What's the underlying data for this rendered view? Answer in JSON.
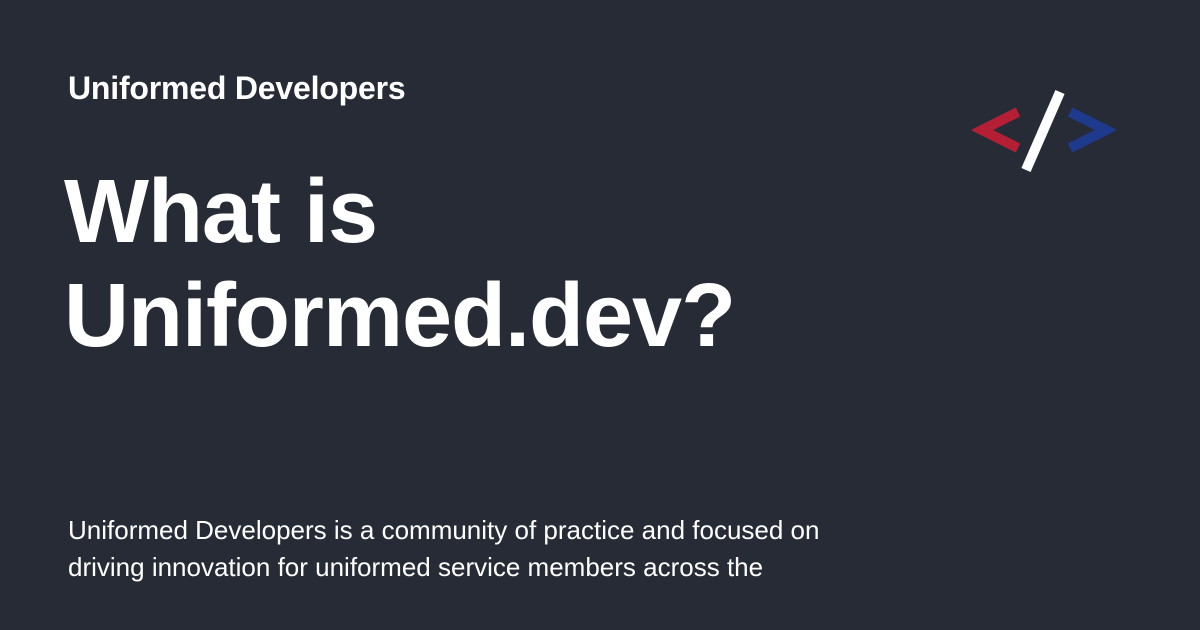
{
  "header": {
    "site_name": "Uniformed Developers"
  },
  "headline": {
    "line1": "What is",
    "line2": "Uniformed.dev?"
  },
  "description": {
    "line1": "Uniformed Developers is a community of practice and focused on",
    "line2": "driving innovation for uniformed service members across the"
  },
  "logo": {
    "icon": "code-brackets-icon",
    "left_color": "#b51f36",
    "slash_color": "#ffffff",
    "right_color": "#1d3a8c"
  },
  "colors": {
    "background": "#272b36",
    "text": "#ffffff"
  }
}
